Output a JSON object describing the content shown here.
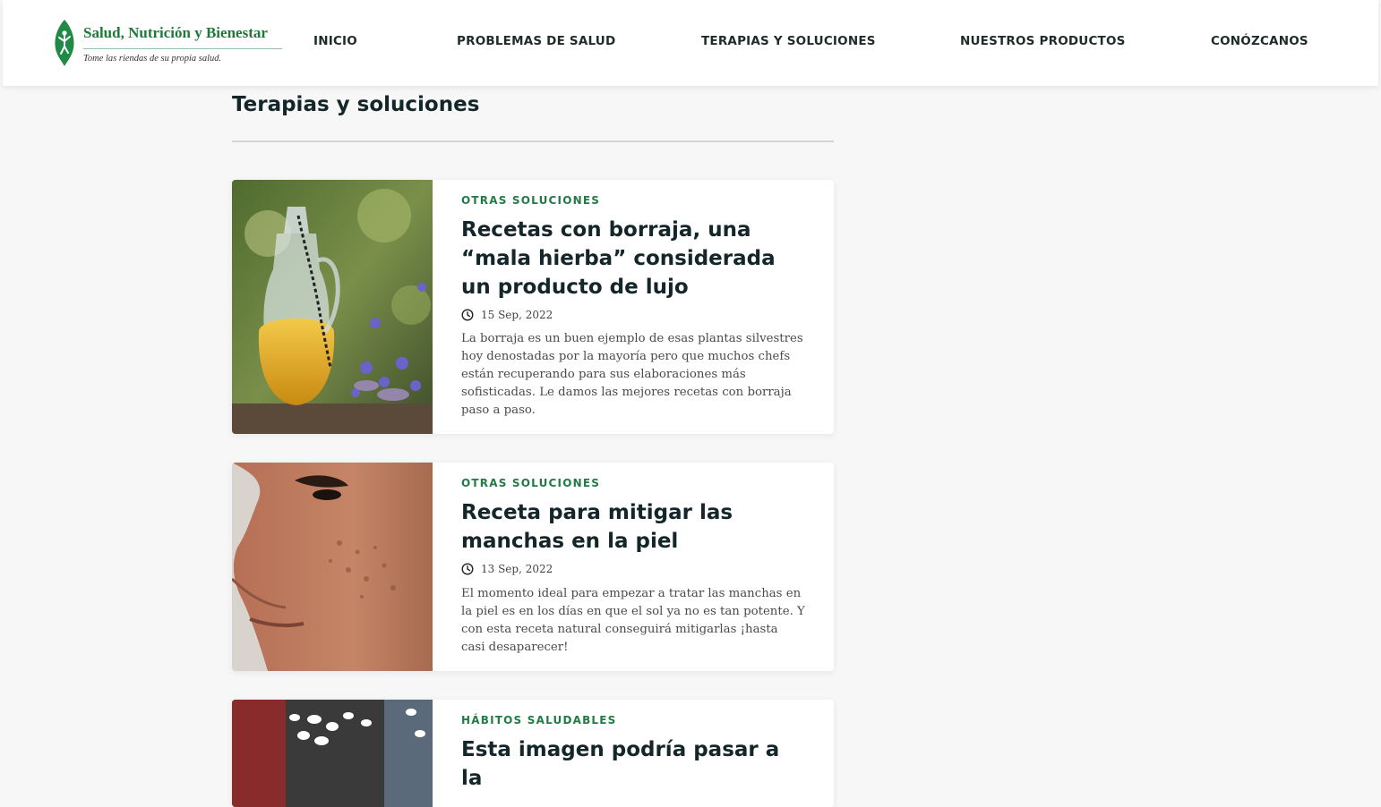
{
  "site": {
    "name": "Salud, Nutrición y Bienestar",
    "tagline": "Tome las riendas de su propia salud."
  },
  "nav": [
    {
      "label": "INICIO"
    },
    {
      "label": "PROBLEMAS DE SALUD"
    },
    {
      "label": "TERAPIAS Y SOLUCIONES"
    },
    {
      "label": "NUESTROS PRODUCTOS"
    },
    {
      "label": "CONÓZCANOS"
    }
  ],
  "page": {
    "title": "Terapias y soluciones"
  },
  "articles": [
    {
      "category": "OTRAS SOLUCIONES",
      "title": "Recetas con borraja, una “mala hierba” considerada un producto de lujo",
      "date": "15 Sep, 2022",
      "excerpt": "La borraja es un buen ejemplo de esas plantas silvestres hoy denostadas por la mayoría pero que muchos chefs están recuperando para sus elaboraciones más sofisticadas. Le damos las mejores recetas con borraja paso a paso.",
      "image": "borage-oil-bottle-photo"
    },
    {
      "category": "OTRAS SOLUCIONES",
      "title": "Receta para mitigar las manchas en la piel",
      "date": "13 Sep, 2022",
      "excerpt": "El momento ideal para empezar a tratar las manchas en la piel es en los días en que el sol ya no es tan potente. Y con esta receta natural conseguirá mitigarlas ¡hasta casi desaparecer!",
      "image": "face-skin-spots-photo"
    },
    {
      "category": "HÁBITOS SALUDABLES",
      "title": "Esta imagen podría pasar a la",
      "image": "store-lights-photo"
    }
  ],
  "colors": {
    "brand_green": "#1f7a3a",
    "category_green": "#237a46",
    "heading": "#14262a",
    "background": "#f7f7f7"
  },
  "icons": [
    "clock-icon",
    "leaf-logo-icon"
  ]
}
